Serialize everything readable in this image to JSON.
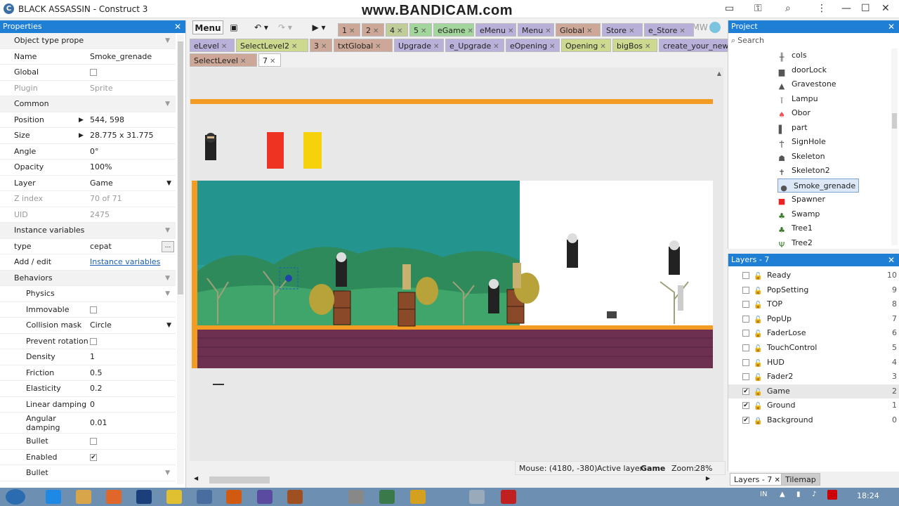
{
  "app": {
    "title": "BLACK ASSASSIN - Construct 3",
    "watermark": "www.BANDICAM.com"
  },
  "properties": {
    "header": "Properties",
    "rows": [
      {
        "name": "Object type properties",
        "value": "",
        "kind": "group"
      },
      {
        "name": "Name",
        "value": "Smoke_grenade"
      },
      {
        "name": "Global",
        "value": "",
        "kind": "check",
        "checked": false
      },
      {
        "name": "Plugin",
        "value": "Sprite",
        "kind": "dim"
      },
      {
        "name": "Common",
        "value": "",
        "kind": "group"
      },
      {
        "name": "Position",
        "value": "544, 598",
        "kind": "expand"
      },
      {
        "name": "Size",
        "value": "28.775 x 31.775",
        "kind": "expand"
      },
      {
        "name": "Angle",
        "value": "0°"
      },
      {
        "name": "Opacity",
        "value": "100%"
      },
      {
        "name": "Layer",
        "value": "Game",
        "kind": "dropdown"
      },
      {
        "name": "Z index",
        "value": "70 of 71",
        "kind": "dim"
      },
      {
        "name": "UID",
        "value": "2475",
        "kind": "dim"
      },
      {
        "name": "Instance variables",
        "value": "",
        "kind": "group"
      },
      {
        "name": "type",
        "value": "cepat",
        "kind": "button",
        "button": "..."
      },
      {
        "name": "Add / edit",
        "value": "Instance variables",
        "kind": "link"
      },
      {
        "name": "Behaviors",
        "value": "",
        "kind": "group"
      },
      {
        "name": "Physics",
        "value": "",
        "kind": "subgroup"
      },
      {
        "name": "Immovable",
        "value": "",
        "kind": "check",
        "checked": false,
        "sub": true
      },
      {
        "name": "Collision mask",
        "value": "Circle",
        "kind": "dropdown",
        "sub": true
      },
      {
        "name": "Prevent rotation",
        "value": "",
        "kind": "check",
        "checked": false,
        "sub": true
      },
      {
        "name": "Density",
        "value": "1",
        "sub": true
      },
      {
        "name": "Friction",
        "value": "0.5",
        "sub": true
      },
      {
        "name": "Elasticity",
        "value": "0.2",
        "sub": true
      },
      {
        "name": "Linear damping",
        "value": "0",
        "sub": true
      },
      {
        "name": "Angular damping",
        "value": "0.01",
        "sub": true,
        "tall": true
      },
      {
        "name": "Bullet",
        "value": "",
        "kind": "check",
        "checked": false,
        "sub": true
      },
      {
        "name": "Enabled",
        "value": "",
        "kind": "check",
        "checked": true,
        "sub": true
      },
      {
        "name": "Bullet",
        "value": "",
        "kind": "subgroup"
      }
    ]
  },
  "toolbar": {
    "menu_label": "Menu",
    "save_icon": "floppy-icon",
    "undo_icon": "undo-icon",
    "redo_icon": "redo-icon",
    "play_icon": "play-icon",
    "user_label": "DMW"
  },
  "tabs": {
    "row1": [
      {
        "label": "1",
        "color": "#cda898"
      },
      {
        "label": "2",
        "color": "#cda898"
      },
      {
        "label": "4",
        "color": "#c0cd98"
      },
      {
        "label": "5",
        "color": "#a3d69c"
      },
      {
        "label": "eGame",
        "color": "#a3d69c"
      },
      {
        "label": "eMenu",
        "color": "#b9b1d9"
      },
      {
        "label": "Menu",
        "color": "#b9b1d9"
      },
      {
        "label": "Global",
        "color": "#cda898"
      },
      {
        "label": "Store",
        "color": "#b9b1d9"
      },
      {
        "label": "e_Store",
        "color": "#b9b1d9"
      }
    ],
    "row2": [
      {
        "label": "eLevel",
        "color": "#b9b1d9"
      },
      {
        "label": "SelectLevel2",
        "color": "#cdd98f"
      },
      {
        "label": "3",
        "color": "#cda898"
      },
      {
        "label": "txtGlobal",
        "color": "#cda898"
      },
      {
        "label": "Upgrade",
        "color": "#b9b1d9"
      },
      {
        "label": "e_Upgrade",
        "color": "#b9b1d9"
      },
      {
        "label": "eOpening",
        "color": "#b9b1d9"
      },
      {
        "label": "Opening",
        "color": "#cdd98f"
      },
      {
        "label": "bigBos",
        "color": "#cdd98f"
      },
      {
        "label": "create_your_new_level",
        "color": "#b9b1d9"
      }
    ],
    "row3": [
      {
        "label": "SelectLevel",
        "color": "#cda898"
      },
      {
        "label": "7",
        "color": "#ffffff"
      }
    ]
  },
  "status": {
    "mouse": "Mouse: (4180, -380)",
    "active_layer_label": "Active layer:",
    "active_layer": "Game",
    "zoom_label": "Zoom:",
    "zoom": "28%"
  },
  "project": {
    "header": "Project",
    "search_placeholder": "Search",
    "items": [
      {
        "name": "cols",
        "icon": "cols-icon",
        "glyph": "╫"
      },
      {
        "name": "doorLock",
        "icon": "door-icon",
        "glyph": "▆"
      },
      {
        "name": "Gravestone",
        "icon": "gravestone-icon",
        "glyph": "▲"
      },
      {
        "name": "Lampu",
        "icon": "lamp-icon",
        "glyph": "ǐ"
      },
      {
        "name": "Obor",
        "icon": "torch-icon",
        "glyph": "♠"
      },
      {
        "name": "part",
        "icon": "part-icon",
        "glyph": "▌"
      },
      {
        "name": "SignHole",
        "icon": "sign-icon",
        "glyph": "Ϯ"
      },
      {
        "name": "Skeleton",
        "icon": "skeleton-icon",
        "glyph": "☗"
      },
      {
        "name": "Skeleton2",
        "icon": "skeleton2-icon",
        "glyph": "✝"
      },
      {
        "name": "Smoke_grenade",
        "icon": "grenade-icon",
        "glyph": "●",
        "selected": true
      },
      {
        "name": "Spawner",
        "icon": "spawner-icon",
        "glyph": "■"
      },
      {
        "name": "Swamp",
        "icon": "swamp-icon",
        "glyph": "♣"
      },
      {
        "name": "Tree1",
        "icon": "tree1-icon",
        "glyph": "♣"
      },
      {
        "name": "Tree2",
        "icon": "tree2-icon",
        "glyph": "Ψ"
      }
    ]
  },
  "layers": {
    "header": "Layers - 7",
    "items": [
      {
        "name": "Ready",
        "num": "10",
        "checked": false
      },
      {
        "name": "PopSetting",
        "num": "9",
        "checked": false
      },
      {
        "name": "TOP",
        "num": "8",
        "checked": false
      },
      {
        "name": "PopUp",
        "num": "7",
        "checked": false
      },
      {
        "name": "FaderLose",
        "num": "6",
        "checked": false
      },
      {
        "name": "TouchControl",
        "num": "5",
        "checked": false
      },
      {
        "name": "HUD",
        "num": "4",
        "checked": false
      },
      {
        "name": "Fader2",
        "num": "3",
        "checked": false
      },
      {
        "name": "Game",
        "num": "2",
        "checked": true,
        "selected": true
      },
      {
        "name": "Ground",
        "num": "1",
        "checked": true
      },
      {
        "name": "Background",
        "num": "0",
        "checked": true,
        "locked": true
      }
    ]
  },
  "bottom_tabs": [
    {
      "label": "Layers - 7",
      "active": true
    },
    {
      "label": "Tilemap",
      "active": false
    }
  ],
  "taskbar": {
    "lang": "IN",
    "time": "18:24",
    "apps": [
      "start-icon",
      "ie-icon",
      "explorer-icon",
      "firefox-icon",
      "photoshop-icon",
      "chrome-icon",
      "app1-icon",
      "app2-icon",
      "app3-icon",
      "winrar-icon",
      "settings-icon",
      "app4-icon",
      "app5-icon",
      "app6-icon",
      "app7-icon"
    ]
  }
}
